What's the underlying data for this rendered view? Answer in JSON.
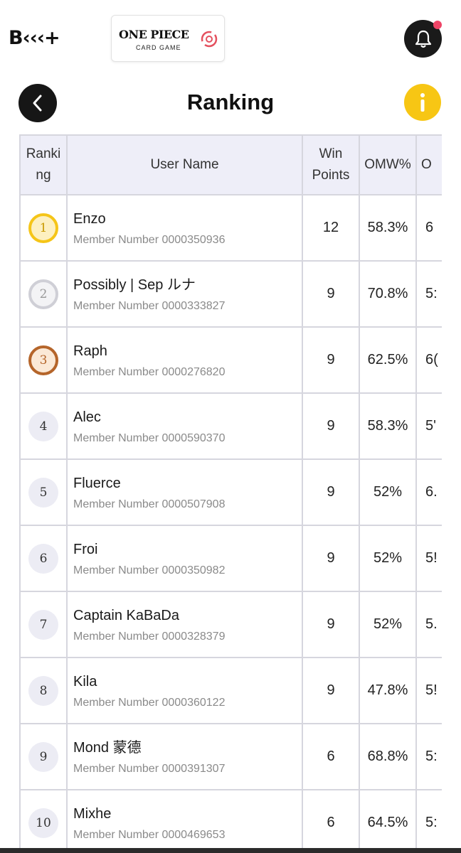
{
  "header": {
    "brand_text": "B‹‹‹+",
    "game_title": "ONE PIECE",
    "game_subtitle": "CARD GAME"
  },
  "page": {
    "title": "Ranking"
  },
  "table": {
    "headers": {
      "ranking": "Ranki ng",
      "user_name": "User Name",
      "win_points": "Win Points",
      "omw": "OMW%",
      "oomw": "O"
    },
    "member_prefix": "Member Number",
    "rows": [
      {
        "rank": "1",
        "name": "Enzo",
        "member": "Member Number 0000350936",
        "win": "12",
        "omw": "58.3%",
        "oomw": "6"
      },
      {
        "rank": "2",
        "name": "Possibly | Sep ルナ",
        "member": "Member Number 0000333827",
        "win": "9",
        "omw": "70.8%",
        "oomw": "5:"
      },
      {
        "rank": "3",
        "name": "Raph",
        "member": "Member Number 0000276820",
        "win": "9",
        "omw": "62.5%",
        "oomw": "6("
      },
      {
        "rank": "4",
        "name": "Alec",
        "member": "Member Number 0000590370",
        "win": "9",
        "omw": "58.3%",
        "oomw": "5'"
      },
      {
        "rank": "5",
        "name": "Fluerce",
        "member": "Member Number 0000507908",
        "win": "9",
        "omw": "52%",
        "oomw": "6."
      },
      {
        "rank": "6",
        "name": "Froi",
        "member": "Member Number 0000350982",
        "win": "9",
        "omw": "52%",
        "oomw": "5!"
      },
      {
        "rank": "7",
        "name": "Captain KaBaDa",
        "member": "Member Number 0000328379",
        "win": "9",
        "omw": "52%",
        "oomw": "5."
      },
      {
        "rank": "8",
        "name": "Kila",
        "member": "Member Number 0000360122",
        "win": "9",
        "omw": "47.8%",
        "oomw": "5!"
      },
      {
        "rank": "9",
        "name": "Mond 蒙德",
        "member": "Member Number 0000391307",
        "win": "6",
        "omw": "68.8%",
        "oomw": "5:"
      },
      {
        "rank": "10",
        "name": "Mixhe",
        "member": "Member Number 0000469653",
        "win": "6",
        "omw": "64.5%",
        "oomw": "5:"
      }
    ]
  },
  "colors": {
    "gold": "#f5c518",
    "silver": "#cfcfd6",
    "bronze": "#b5652a",
    "info": "#f7c614",
    "notification_dot": "#ee4466"
  },
  "icons": [
    "bell-icon",
    "chevron-left-icon",
    "info-icon",
    "logo-mark-icon"
  ]
}
